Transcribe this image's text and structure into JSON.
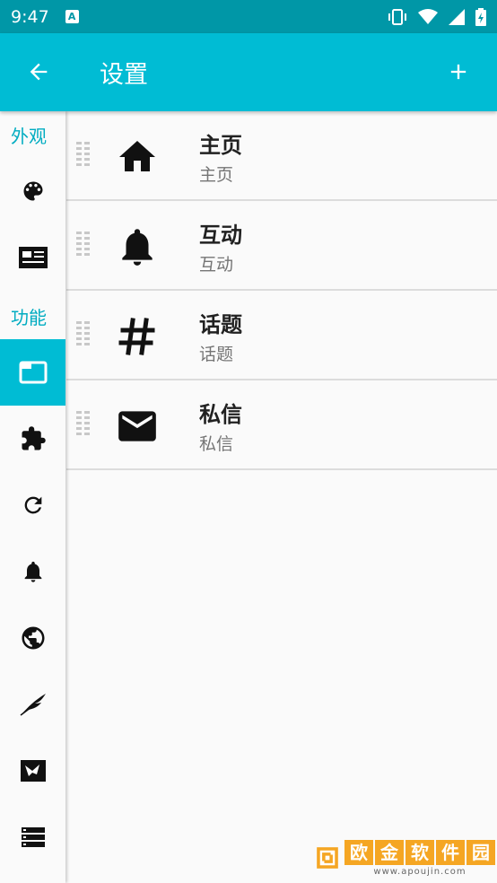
{
  "status_bar": {
    "time": "9:47",
    "badge": "A"
  },
  "app_bar": {
    "title": "设置"
  },
  "sidebar": {
    "sections": [
      {
        "label": "外观"
      },
      {
        "label": "功能"
      }
    ],
    "items": [
      {
        "icon": "palette-icon"
      },
      {
        "icon": "article-icon"
      },
      {
        "icon": "tab-icon",
        "active": true
      },
      {
        "icon": "extension-icon"
      },
      {
        "icon": "refresh-icon"
      },
      {
        "icon": "bell-icon"
      },
      {
        "icon": "globe-icon"
      },
      {
        "icon": "feather-icon"
      },
      {
        "icon": "bird-icon"
      },
      {
        "icon": "storage-icon"
      }
    ]
  },
  "tabs_list": [
    {
      "title": "主页",
      "subtitle": "主页",
      "icon": "home-icon"
    },
    {
      "title": "互动",
      "subtitle": "互动",
      "icon": "bell-icon"
    },
    {
      "title": "话题",
      "subtitle": "话题",
      "icon": "hashtag-icon"
    },
    {
      "title": "私信",
      "subtitle": "私信",
      "icon": "mail-icon"
    }
  ],
  "watermark": {
    "chars": [
      "欧",
      "金",
      "软",
      "件",
      "园"
    ],
    "url": "www.apoujin.com"
  },
  "colors": {
    "primary": "#00bcd4",
    "primary_dark": "#0097a7",
    "accent_text": "#00acc1"
  }
}
